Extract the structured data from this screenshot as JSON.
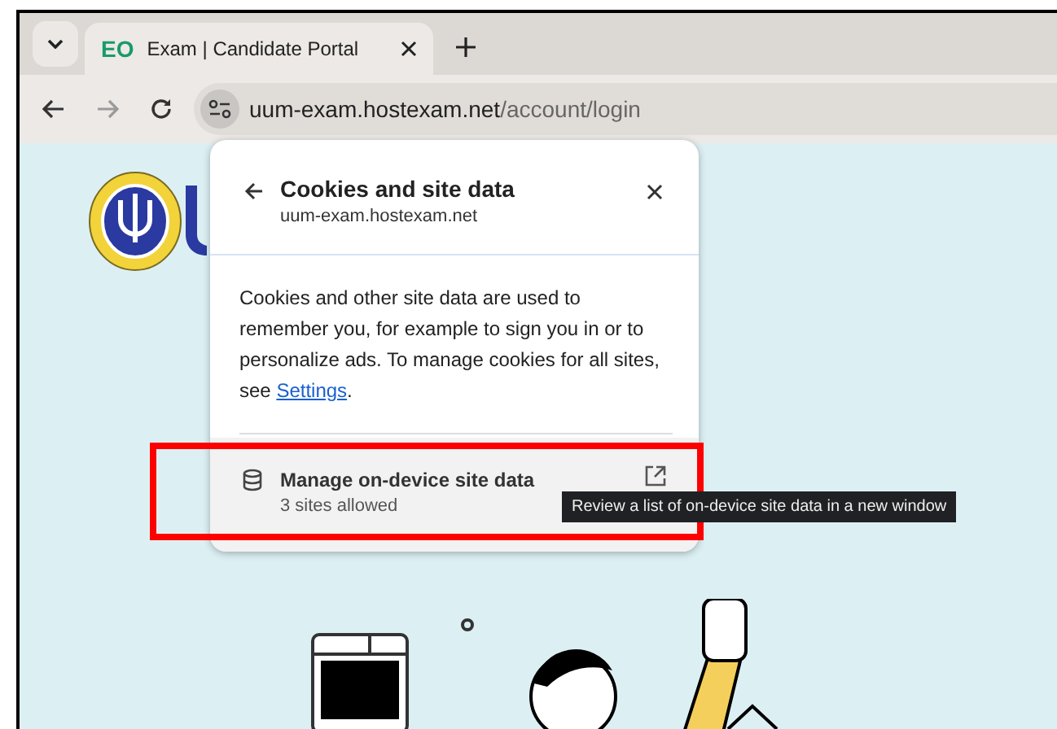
{
  "tabs": [
    {
      "favicon": "EO",
      "title": "Exam | Candidate Portal",
      "selected": true
    }
  ],
  "toolbar": {
    "forward_disabled": true,
    "url_host": "uum-exam.hostexam.net",
    "url_path": "/account/login"
  },
  "popup": {
    "title": "Cookies and site data",
    "subtitle": "uum-exam.hostexam.net",
    "body": "Cookies and other site data are used to remember you, for example to sign you in or to personalize ads. To manage cookies for all sites, see ",
    "link": "Settings",
    "body_end": ".",
    "row": {
      "title": "Manage on-device site data",
      "subtitle": "3 sites allowed"
    }
  },
  "tooltip": "Review a list of on-device site data in a new window"
}
